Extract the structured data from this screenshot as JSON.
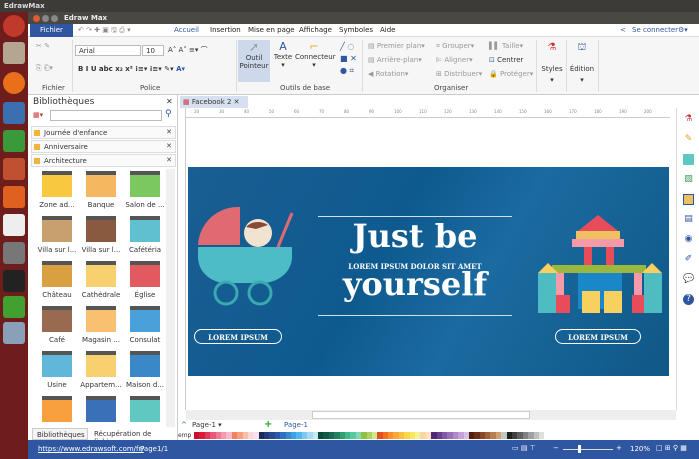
{
  "os": {
    "top_title": "EdrawMax"
  },
  "window": {
    "title": "Edraw Max"
  },
  "menu": {
    "file": "Fichier",
    "tabs": [
      "Accueil",
      "Insertion",
      "Mise en page",
      "Affichage",
      "Symboles",
      "Aide"
    ],
    "login": "Se connecter"
  },
  "ribbon": {
    "groups": {
      "file": "Fichier",
      "font": "Police",
      "basic_tools": "Outils de base",
      "arrange": "Organiser"
    },
    "font_name": "Arial",
    "font_size": "10",
    "pointer": [
      "Outil",
      "Pointeur"
    ],
    "text": "Texte",
    "connector": "Connecteur",
    "arrange": [
      "Premier plan",
      "Grouper",
      "Taille",
      "Arrière-plan",
      "Aligner",
      "Centrer",
      "Rotation",
      "Distribuer",
      "Protéger"
    ],
    "styles": "Styles",
    "edit": "Édition"
  },
  "library": {
    "title": "Bibliothèques",
    "search_value": "",
    "sections": [
      "Journée d'enfance",
      "Anniversaire",
      "Architecture"
    ],
    "items": [
      "Zone ad...",
      "Banque",
      "Salon de ...",
      "Villa sur l...",
      "Villa sur l...",
      "Cafétéria",
      "Château",
      "Cathédrale",
      "Église",
      "Café",
      "Magasin ...",
      "Consulat",
      "Usine",
      "Appartem...",
      "Maison d...",
      "",
      "",
      ""
    ],
    "bottom_tabs": [
      "Bibliothèques",
      "Récupération de fichier"
    ]
  },
  "document": {
    "tab": "Facebook 2",
    "ruler": [
      "20",
      "30",
      "40",
      "50",
      "60",
      "70",
      "80",
      "90",
      "100",
      "110",
      "120",
      "130",
      "140",
      "150",
      "160",
      "170",
      "180",
      "190",
      "200"
    ]
  },
  "banner": {
    "line1": "Just be",
    "subtitle": "LOREM IPSUM DOLOR SIT AMET",
    "line2": "yourself",
    "button_left": "LOREM IPSUM",
    "button_right": "LOREM IPSUM"
  },
  "pages": {
    "selector": "Page-1",
    "active_tab": "Page-1",
    "palette_label": "emp"
  },
  "palette": [
    "#c8102e",
    "#d91a3a",
    "#e03a5a",
    "#e8567a",
    "#f07890",
    "#f49ab0",
    "#f8b8c8",
    "#f08060",
    "#f4a080",
    "#f8c0a8",
    "#fcd8d0",
    "#f8e0f0",
    "#1a2a5a",
    "#243a7a",
    "#2a4a90",
    "#2a5aa8",
    "#3070c0",
    "#3a88d0",
    "#40a0e0",
    "#50b8f0",
    "#80c8f0",
    "#a8d8f4",
    "#c8e8f8",
    "#0a4a3a",
    "#105a48",
    "#186a50",
    "#208060",
    "#30a070",
    "#40b888",
    "#58c8a0",
    "#80d8b8",
    "#90c040",
    "#b0d060",
    "#d0e890",
    "#e05020",
    "#f07020",
    "#f89030",
    "#f8a838",
    "#f8c040",
    "#f8d848",
    "#f8e860",
    "#f8f098",
    "#f8d8a0",
    "#fce0c0",
    "#502870",
    "#684090",
    "#8058a8",
    "#9870b8",
    "#b088c8",
    "#c8a0d8",
    "#d8c0e8",
    "#502010",
    "#6a3018",
    "#884828",
    "#a06038",
    "#b88050",
    "#d0a070",
    "#c0c8c0",
    "#202020",
    "#404040",
    "#606060",
    "#808080",
    "#a0a0a0",
    "#c0c0c0",
    "#e0e0e0"
  ],
  "status": {
    "url": "https://www.edrawsoft.com/fr/",
    "page": "Page1/1",
    "zoom": "120%",
    "zoom_fraction": 0.3
  }
}
